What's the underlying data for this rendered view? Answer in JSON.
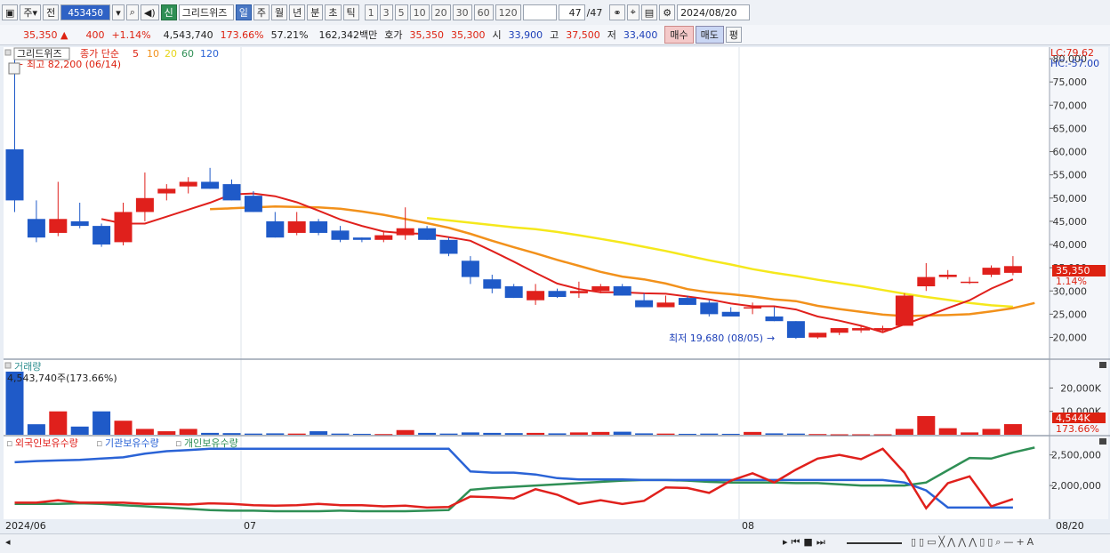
{
  "toolbar": {
    "market": "주",
    "prev": "전",
    "code": "453450",
    "sin": "신",
    "name": "그리드위즈",
    "periods": [
      "일",
      "주",
      "월",
      "년",
      "분",
      "초",
      "틱"
    ],
    "selected_period": "일",
    "intervals": [
      "1",
      "3",
      "5",
      "10",
      "20",
      "30",
      "60",
      "120"
    ],
    "count": "47",
    "total": "/47",
    "date": "2024/08/20"
  },
  "quote": {
    "price": "35,350",
    "arrow": "▲",
    "change": "400",
    "change_pct": "+1.14%",
    "volume": "4,543,740",
    "volume_ratio": "173.66%",
    "turnover": "57.21%",
    "amount": "162,342백만",
    "hoga_label": "호가",
    "hoga_ask": "35,350",
    "hoga_bid": "35,300",
    "open_label": "시",
    "open": "33,900",
    "high_label": "고",
    "high": "37,500",
    "low_label": "저",
    "low": "33,400",
    "buy": "매수",
    "sell": "매도",
    "eval": "평"
  },
  "colors": {
    "up": "#e0201c",
    "down": "#1f5ac8",
    "ma5": "#e0201c",
    "ma10": "#f2911b",
    "ma20": "#f5e81c",
    "foreign": "#e0201c",
    "institution": "#2a63d6",
    "individual": "#2f8f55"
  },
  "chart_data": [
    {
      "type": "candlestick",
      "legend": {
        "name": "그리드위즈",
        "ma_label": "종가 단순",
        "periods": [
          "5",
          "10",
          "20",
          "60",
          "120"
        ]
      },
      "lc": "LC:79.62",
      "hc": "HC:-57.00",
      "ylim": [
        15500,
        82500
      ],
      "y_ticks": [
        "80,000",
        "75,000",
        "70,000",
        "65,000",
        "60,000",
        "55,000",
        "50,000",
        "45,000",
        "40,000",
        "35,000",
        "30,000",
        "25,000",
        "20,000"
      ],
      "price_tag": "35,350",
      "price_tag_pct": "1.14%",
      "high_annotation": "최고 82,200 (06/14)",
      "low_annotation": "최저 19,680 (08/05)",
      "ohlc": [
        [
          60500,
          82200,
          47000,
          49500
        ],
        [
          45500,
          49500,
          40500,
          41500
        ],
        [
          42500,
          53500,
          41800,
          45500
        ],
        [
          45000,
          49000,
          43500,
          44000
        ],
        [
          44000,
          44500,
          39500,
          40000
        ],
        [
          40500,
          49000,
          39800,
          47000
        ],
        [
          47000,
          55500,
          45000,
          50000
        ],
        [
          51000,
          53000,
          49500,
          52000
        ],
        [
          52500,
          54500,
          51000,
          53500
        ],
        [
          53500,
          56500,
          52000,
          52000
        ],
        [
          53000,
          54000,
          49500,
          49500
        ],
        [
          50500,
          51500,
          47000,
          47000
        ],
        [
          45000,
          47000,
          41500,
          41500
        ],
        [
          42500,
          47000,
          42000,
          45000
        ],
        [
          45000,
          45500,
          42000,
          42500
        ],
        [
          43000,
          44000,
          40500,
          41000
        ],
        [
          41500,
          41500,
          40500,
          41000
        ],
        [
          41000,
          43000,
          40500,
          42000
        ],
        [
          42000,
          48000,
          41000,
          43500
        ],
        [
          43500,
          44000,
          41000,
          41000
        ],
        [
          41000,
          41500,
          37500,
          38000
        ],
        [
          36500,
          37500,
          31500,
          33000
        ],
        [
          32500,
          33500,
          29500,
          30500
        ],
        [
          31000,
          31500,
          28500,
          28500
        ],
        [
          28000,
          31500,
          27000,
          30000
        ],
        [
          30000,
          30500,
          28500,
          28700
        ],
        [
          29500,
          32000,
          28500,
          30000
        ],
        [
          30000,
          31500,
          29500,
          31000
        ],
        [
          31000,
          31500,
          29000,
          29000
        ],
        [
          28000,
          29500,
          26500,
          26500
        ],
        [
          26500,
          29000,
          26500,
          27500
        ],
        [
          28500,
          29000,
          27000,
          27000
        ],
        [
          27500,
          28000,
          24500,
          25000
        ],
        [
          25500,
          26500,
          24500,
          24500
        ],
        [
          26500,
          27500,
          25000,
          26500
        ],
        [
          24500,
          26500,
          23500,
          23500
        ],
        [
          23500,
          23500,
          19680,
          19900
        ],
        [
          20000,
          21000,
          19700,
          21000
        ],
        [
          21000,
          22000,
          20500,
          22000
        ],
        [
          21500,
          22500,
          21000,
          22000
        ],
        [
          21500,
          22500,
          21000,
          22000
        ],
        [
          22500,
          29500,
          22500,
          29000
        ],
        [
          31000,
          36000,
          30000,
          33000
        ],
        [
          33000,
          34500,
          32500,
          33500
        ],
        [
          32000,
          33000,
          31500,
          32000
        ],
        [
          33500,
          35500,
          33000,
          35000
        ],
        [
          33900,
          37500,
          33400,
          35350
        ]
      ],
      "ma5": [
        null,
        null,
        null,
        null,
        45500,
        44500,
        44500,
        46000,
        47500,
        49000,
        50800,
        51000,
        50400,
        49100,
        47300,
        45400,
        44000,
        42800,
        42400,
        42300,
        41600,
        40800,
        38600,
        36300,
        33900,
        31600,
        30400,
        29700,
        29700,
        29500,
        29400,
        28800,
        28200,
        27300,
        26700,
        26700,
        26000,
        24500,
        23600,
        22500,
        21100,
        22800,
        24500,
        26300,
        28000,
        30500,
        32500
      ],
      "ma10": [
        null,
        null,
        null,
        null,
        null,
        null,
        null,
        null,
        null,
        47600,
        47800,
        48000,
        48200,
        48100,
        48000,
        47700,
        47100,
        46400,
        45500,
        44600,
        43600,
        42300,
        40800,
        39400,
        38100,
        36700,
        35400,
        34100,
        33100,
        32500,
        31600,
        30400,
        29700,
        29300,
        28800,
        28200,
        27800,
        26800,
        26100,
        25500,
        24900,
        24600,
        24700,
        24800,
        25000,
        25600,
        26300,
        27400
      ],
      "ma20": [
        null,
        null,
        null,
        null,
        null,
        null,
        null,
        null,
        null,
        null,
        null,
        null,
        null,
        null,
        null,
        null,
        null,
        null,
        null,
        45700,
        45200,
        44700,
        44200,
        43700,
        43300,
        42700,
        42000,
        41200,
        40400,
        39500,
        38600,
        37600,
        36600,
        35700,
        34700,
        33900,
        33200,
        32400,
        31700,
        31000,
        30200,
        29400,
        28700,
        28100,
        27400,
        26900,
        26600
      ]
    },
    {
      "type": "bar",
      "title": "거래량",
      "current_label": "4,543,740주(173.66%)",
      "tag": "4,544K",
      "tag_pct": "173.66%",
      "ylim": [
        0,
        27000000
      ],
      "y_ticks": [
        "20,000K",
        "10,000K"
      ],
      "values": [
        27000000,
        4500000,
        10000000,
        3500000,
        10000000,
        6000000,
        2500000,
        1500000,
        2500000,
        800000,
        700000,
        500000,
        600000,
        500000,
        1500000,
        500000,
        400000,
        300000,
        2000000,
        800000,
        500000,
        1000000,
        800000,
        700000,
        800000,
        600000,
        1000000,
        1200000,
        1300000,
        600000,
        500000,
        400000,
        500000,
        400000,
        1200000,
        600000,
        500000,
        300000,
        200000,
        200000,
        200000,
        2500000,
        8000000,
        2800000,
        1000000,
        2500000,
        4544000
      ]
    },
    {
      "type": "line",
      "series": [
        {
          "name": "외국인보유수량",
          "values": [
            1720000,
            1720000,
            1760000,
            1720000,
            1720000,
            1720000,
            1700000,
            1700000,
            1690000,
            1710000,
            1700000,
            1680000,
            1670000,
            1680000,
            1700000,
            1680000,
            1680000,
            1660000,
            1670000,
            1640000,
            1650000,
            1820000,
            1810000,
            1790000,
            1940000,
            1850000,
            1700000,
            1760000,
            1700000,
            1750000,
            1970000,
            1960000,
            1880000,
            2080000,
            2200000,
            2050000,
            2260000,
            2440000,
            2500000,
            2430000,
            2600000,
            2210000,
            1630000,
            2040000,
            2150000,
            1660000,
            1780000
          ]
        },
        {
          "name": "기관보유수량",
          "values": [
            2380000,
            2400000,
            2410000,
            2420000,
            2440000,
            2460000,
            2520000,
            2560000,
            2580000,
            2600000,
            2600000,
            2600000,
            2600000,
            2600000,
            2600000,
            2600000,
            2600000,
            2600000,
            2600000,
            2600000,
            2600000,
            2230000,
            2210000,
            2210000,
            2180000,
            2120000,
            2100000,
            2100000,
            2100000,
            2090000,
            2090000,
            2090000,
            2090000,
            2090000,
            2090000,
            2090000,
            2090000,
            2090000,
            2090000,
            2090000,
            2090000,
            2050000,
            1920000,
            1640000,
            1640000,
            1640000,
            1640000
          ]
        },
        {
          "name": "개인보유수량",
          "values": [
            1700000,
            1700000,
            1700000,
            1710000,
            1700000,
            1680000,
            1660000,
            1640000,
            1620000,
            1600000,
            1590000,
            1590000,
            1580000,
            1580000,
            1580000,
            1590000,
            1580000,
            1580000,
            1580000,
            1590000,
            1600000,
            1930000,
            1960000,
            1980000,
            2000000,
            2020000,
            2040000,
            2060000,
            2080000,
            2090000,
            2090000,
            2080000,
            2060000,
            2050000,
            2050000,
            2050000,
            2040000,
            2040000,
            2020000,
            2000000,
            2000000,
            2000000,
            2050000,
            2250000,
            2450000,
            2440000,
            2540000,
            2620000
          ]
        }
      ],
      "ylim": [
        1450000,
        2800000
      ],
      "y_ticks": [
        "2,500,000",
        "2,000,000"
      ]
    }
  ],
  "x_labels": {
    "start": "2024/06",
    "jul": "07",
    "aug": "08",
    "end": "08/20"
  }
}
